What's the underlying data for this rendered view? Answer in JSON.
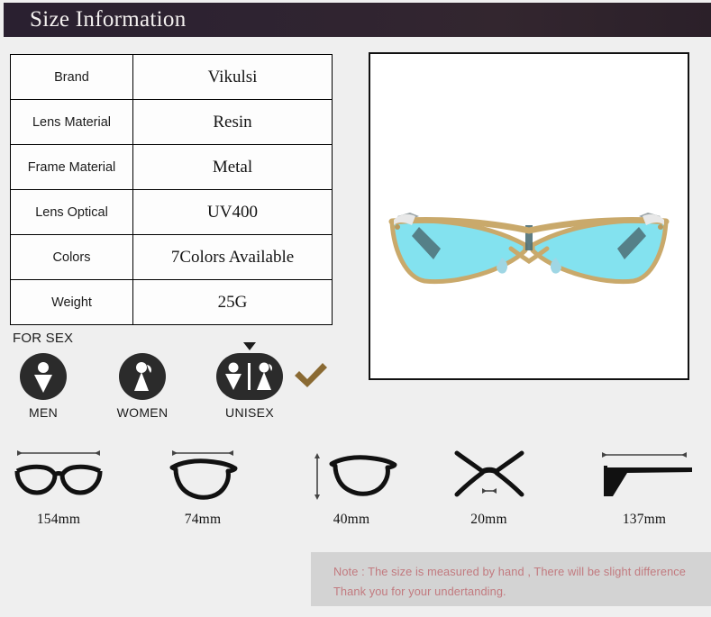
{
  "header": {
    "title": "Size Information"
  },
  "spec_table": {
    "rows": [
      {
        "key": "Brand",
        "value": "Vikulsi"
      },
      {
        "key": "Lens Material",
        "value": "Resin"
      },
      {
        "key": "Frame Material",
        "value": "Metal"
      },
      {
        "key": "Lens Optical",
        "value": "UV400"
      },
      {
        "key": "Colors",
        "value": "7Colors Available"
      },
      {
        "key": "Weight",
        "value": "25G"
      }
    ]
  },
  "product_image": {
    "alt": "cat-eye sunglasses front view",
    "lens_color": "#83e2ef",
    "frame_color": "#c9a96b",
    "temple_color": "#4d6f75",
    "background": "#ffffff"
  },
  "for_sex": {
    "label": "FOR SEX",
    "options": [
      {
        "name": "MEN",
        "icon": "male-pictogram-icon",
        "selected": false
      },
      {
        "name": "WOMEN",
        "icon": "female-pictogram-icon",
        "selected": false
      },
      {
        "name": "UNISEX",
        "icon": "unisex-pictogram-icon",
        "selected": true
      }
    ],
    "selected_marker": "check-mark-icon",
    "pointer": "down-triangle-icon",
    "icon_color": "#2b2b2b",
    "check_color": "#8a6a33"
  },
  "measurements": [
    {
      "label": "154mm",
      "icon": "glasses-front-width-icon",
      "dimension": "total width"
    },
    {
      "label": "74mm",
      "icon": "lens-width-icon",
      "dimension": "lens width"
    },
    {
      "label": "40mm",
      "icon": "lens-height-icon",
      "dimension": "lens height"
    },
    {
      "label": "20mm",
      "icon": "bridge-width-icon",
      "dimension": "bridge width"
    },
    {
      "label": "137mm",
      "icon": "temple-length-icon",
      "dimension": "temple length"
    }
  ],
  "note": {
    "line1": "Note : The size is measured by hand , There will be slight difference",
    "line2": "Thank you for your undertanding.",
    "text_color": "#c27a7f",
    "background": "#d3d3d3"
  }
}
